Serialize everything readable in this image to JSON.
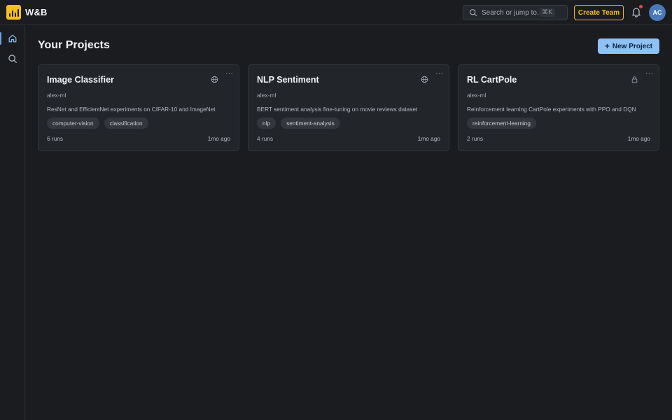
{
  "app": {
    "brand": "W&B",
    "logo_color": "#f5bf1f",
    "accent": "#8ec1f5"
  },
  "header": {
    "search": {
      "placeholder": "Search or jump to...",
      "shortcut": "⌘K"
    },
    "create_team_label": "Create Team",
    "notifications": {
      "icon": "bell-icon",
      "has_unread": true
    },
    "avatar_initials": "AC"
  },
  "sidebar": {
    "items": [
      {
        "name": "home",
        "icon": "home-icon",
        "active": true
      },
      {
        "name": "search",
        "icon": "search-icon",
        "active": false
      }
    ]
  },
  "main": {
    "title": "Your Projects",
    "new_project_label": "New Project",
    "projects": [
      {
        "name": "Image Classifier",
        "owner": "alex-ml",
        "description": "ResNet and EfficientNet experiments on CIFAR-10 and ImageNet",
        "tags": [
          "computer-vision",
          "classification"
        ],
        "runs": "6 runs",
        "updated": "1mo ago",
        "visibility_icon": "globe-icon"
      },
      {
        "name": "NLP Sentiment",
        "owner": "alex-ml",
        "description": "BERT sentiment analysis fine-tuning on movie reviews dataset",
        "tags": [
          "nlp",
          "sentiment-analysis"
        ],
        "runs": "4 runs",
        "updated": "1mo ago",
        "visibility_icon": "globe-icon"
      },
      {
        "name": "RL CartPole",
        "owner": "alex-ml",
        "description": "Reinforcement learning CartPole experiments with PPO and DQN",
        "tags": [
          "reinforcement-learning"
        ],
        "runs": "2 runs",
        "updated": "1mo ago",
        "visibility_icon": "lock-icon"
      }
    ]
  }
}
